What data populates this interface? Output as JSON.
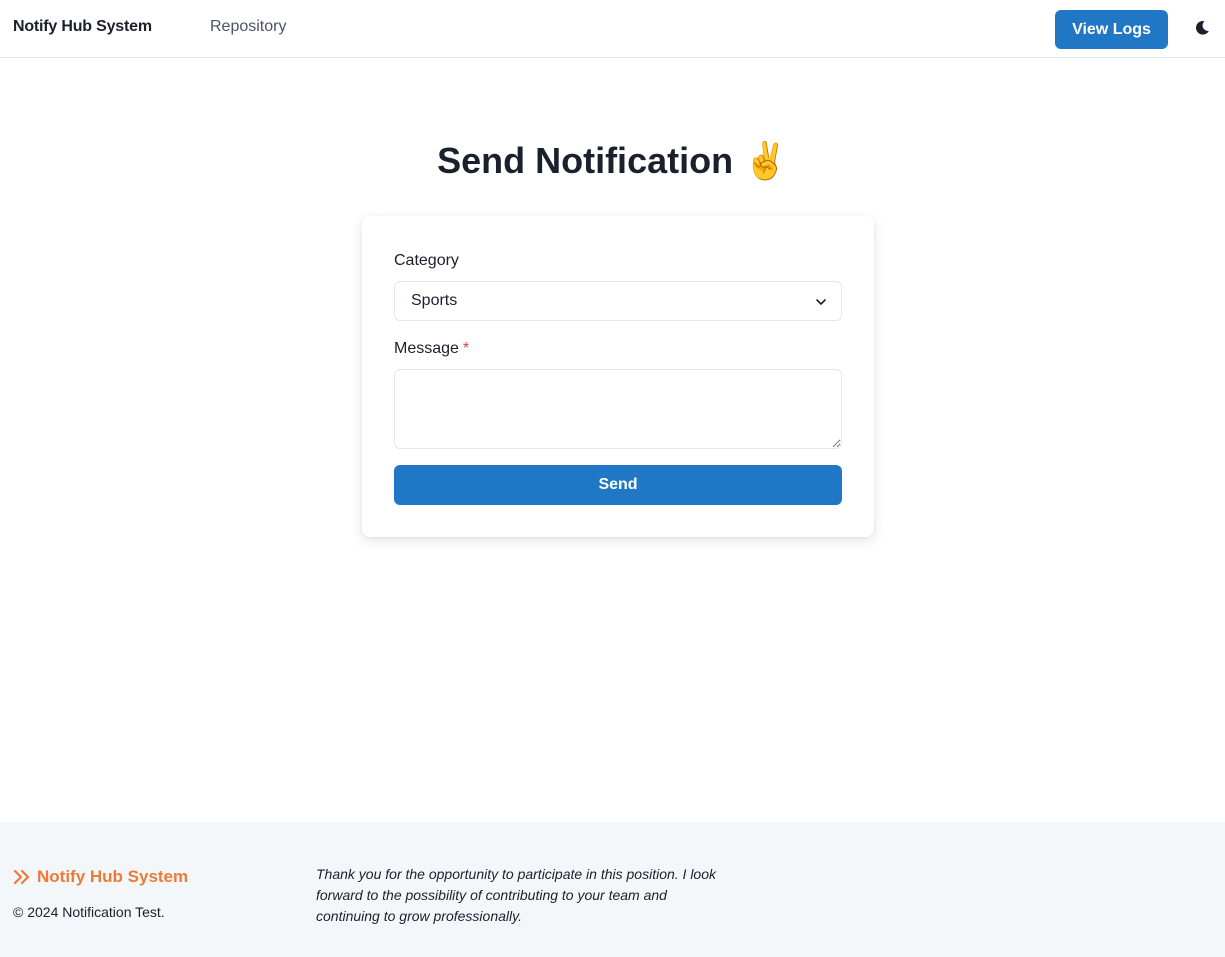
{
  "header": {
    "brand": "Notify Hub System",
    "nav_link": "Repository",
    "view_logs_label": "View Logs",
    "theme_icon": "moon-icon"
  },
  "main": {
    "title": "Send Notification ✌️",
    "form": {
      "category_label": "Category",
      "category_value": "Sports",
      "message_label": "Message",
      "required_marker": "*",
      "message_value": "",
      "send_label": "Send"
    }
  },
  "footer": {
    "brand": "Notify Hub System",
    "brand_icon": "double-chevron-right-icon",
    "copyright": "© 2024 Notification Test.",
    "note": "Thank you for the opportunity to participate in this position. I look forward to the possibility of contributing to your team and continuing to grow professionally."
  },
  "colors": {
    "primary": "#1f77c5",
    "footer_accent": "#ed7a36",
    "footer_bg": "#f4f7fa",
    "required": "#e53e3e"
  }
}
